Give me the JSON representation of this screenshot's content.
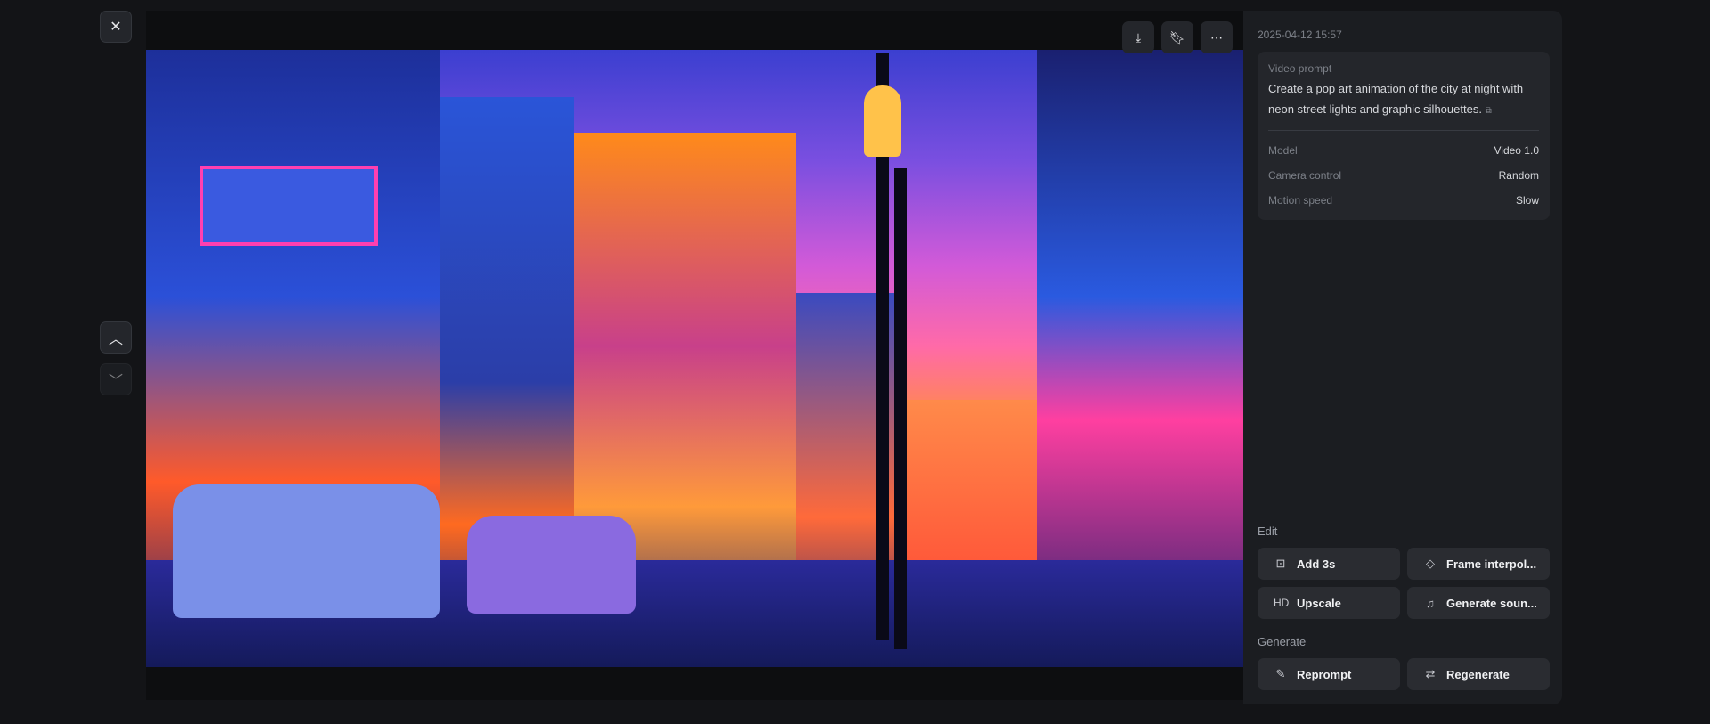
{
  "viewer": {
    "close_icon": "close-icon",
    "prev_icon": "chevron-up-icon",
    "next_icon": "chevron-down-icon",
    "toolbar": {
      "download": "download-icon",
      "bookmark": "bookmark-icon",
      "more": "more-icon"
    },
    "image_alt": "Pop art neon city street at night"
  },
  "panel": {
    "timestamp": "2025-04-12 15:57",
    "prompt_label": "Video prompt",
    "prompt": "Create a pop art animation of the city at night with neon street lights and graphic silhouettes.",
    "details": [
      {
        "label": "Model",
        "value": "Video 1.0"
      },
      {
        "label": "Camera control",
        "value": "Random"
      },
      {
        "label": "Motion speed",
        "value": "Slow"
      }
    ],
    "edit_label": "Edit",
    "edit_buttons": [
      {
        "icon": "clock-plus-icon",
        "label": "Add 3s"
      },
      {
        "icon": "diamond-icon",
        "label": "Frame interpol..."
      },
      {
        "icon": "HD",
        "label": "Upscale"
      },
      {
        "icon": "music-icon",
        "label": "Generate soun..."
      }
    ],
    "generate_label": "Generate",
    "generate_buttons": [
      {
        "icon": "pencil-icon",
        "label": "Reprompt"
      },
      {
        "icon": "repeat-icon",
        "label": "Regenerate"
      }
    ]
  }
}
